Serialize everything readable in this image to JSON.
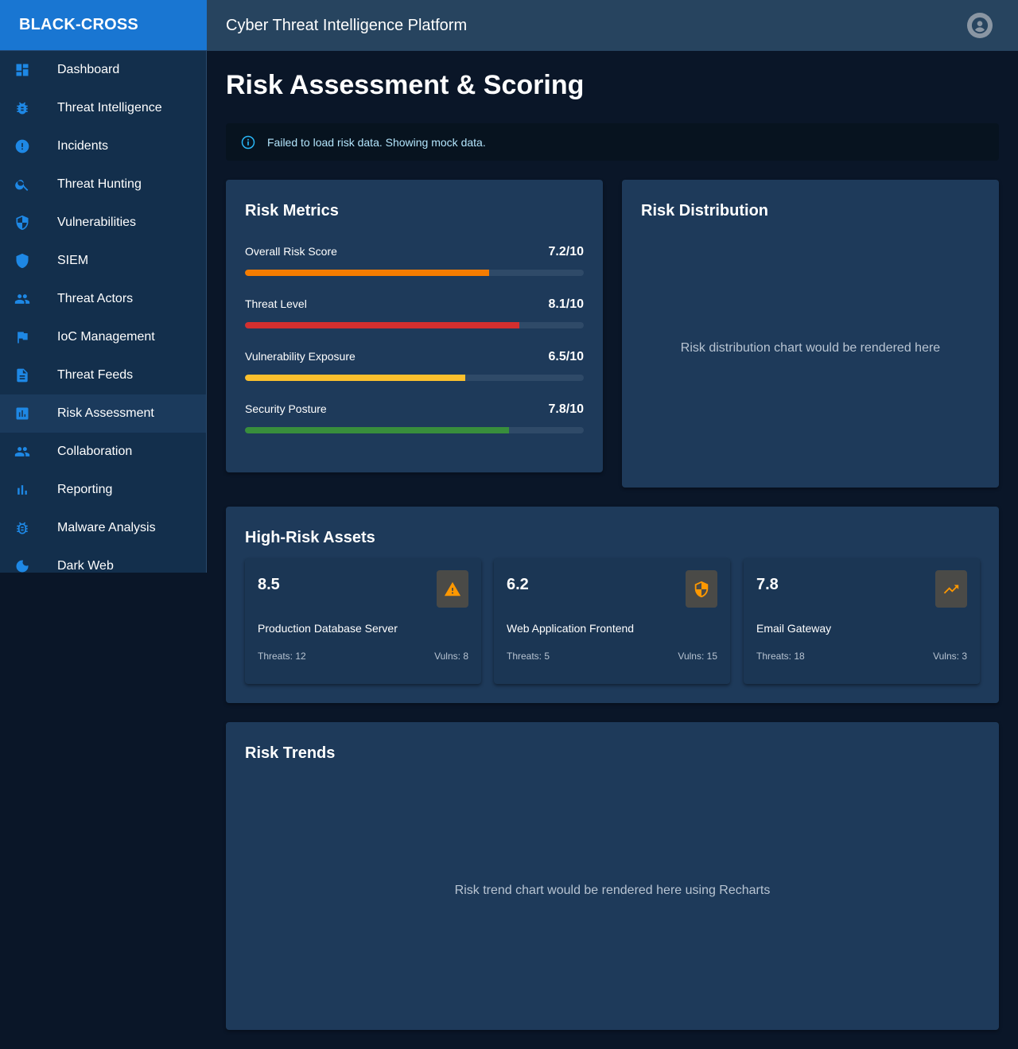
{
  "app": {
    "brand": "BLACK-CROSS",
    "title": "Cyber Threat Intelligence Platform"
  },
  "sidebar": {
    "items": [
      {
        "label": "Dashboard",
        "icon": "dashboard-icon"
      },
      {
        "label": "Threat Intelligence",
        "icon": "bug-icon"
      },
      {
        "label": "Incidents",
        "icon": "alert-circle-icon"
      },
      {
        "label": "Threat Hunting",
        "icon": "search-icon"
      },
      {
        "label": "Vulnerabilities",
        "icon": "shield-half-icon"
      },
      {
        "label": "SIEM",
        "icon": "shield-icon"
      },
      {
        "label": "Threat Actors",
        "icon": "people-icon"
      },
      {
        "label": "IoC Management",
        "icon": "flag-icon"
      },
      {
        "label": "Threat Feeds",
        "icon": "document-icon"
      },
      {
        "label": "Risk Assessment",
        "icon": "assessment-icon",
        "active": true
      },
      {
        "label": "Collaboration",
        "icon": "people-icon"
      },
      {
        "label": "Reporting",
        "icon": "bar-chart-icon"
      },
      {
        "label": "Malware Analysis",
        "icon": "bug-outline-icon"
      },
      {
        "label": "Dark Web",
        "icon": "moon-icon"
      }
    ]
  },
  "page": {
    "title": "Risk Assessment & Scoring"
  },
  "alert": {
    "text": "Failed to load risk data. Showing mock data."
  },
  "risk_metrics": {
    "title": "Risk Metrics",
    "items": [
      {
        "label": "Overall Risk Score",
        "value": "7.2/10",
        "fraction": 0.72,
        "color": "#f57c00"
      },
      {
        "label": "Threat Level",
        "value": "8.1/10",
        "fraction": 0.81,
        "color": "#d32f2f"
      },
      {
        "label": "Vulnerability Exposure",
        "value": "6.5/10",
        "fraction": 0.65,
        "color": "#fbc02d"
      },
      {
        "label": "Security Posture",
        "value": "7.8/10",
        "fraction": 0.78,
        "color": "#388e3c"
      }
    ]
  },
  "risk_distribution": {
    "title": "Risk Distribution",
    "placeholder": "Risk distribution chart would be rendered here"
  },
  "high_risk_assets": {
    "title": "High-Risk Assets",
    "items": [
      {
        "score": "8.5",
        "name": "Production Database Server",
        "threats": "Threats: 12",
        "vulns": "Vulns: 8",
        "icon": "warning-icon"
      },
      {
        "score": "6.2",
        "name": "Web Application Frontend",
        "threats": "Threats: 5",
        "vulns": "Vulns: 15",
        "icon": "security-shield-icon"
      },
      {
        "score": "7.8",
        "name": "Email Gateway",
        "threats": "Threats: 18",
        "vulns": "Vulns: 3",
        "icon": "trending-up-icon"
      }
    ]
  },
  "risk_trends": {
    "title": "Risk Trends",
    "placeholder": "Risk trend chart would be rendered here using Recharts"
  },
  "colors": {
    "accent": "#1976d2",
    "background": "#0a1628",
    "card": "#1e3a5a",
    "sidebar": "#132f4c",
    "icon_orange": "#ff9800"
  }
}
